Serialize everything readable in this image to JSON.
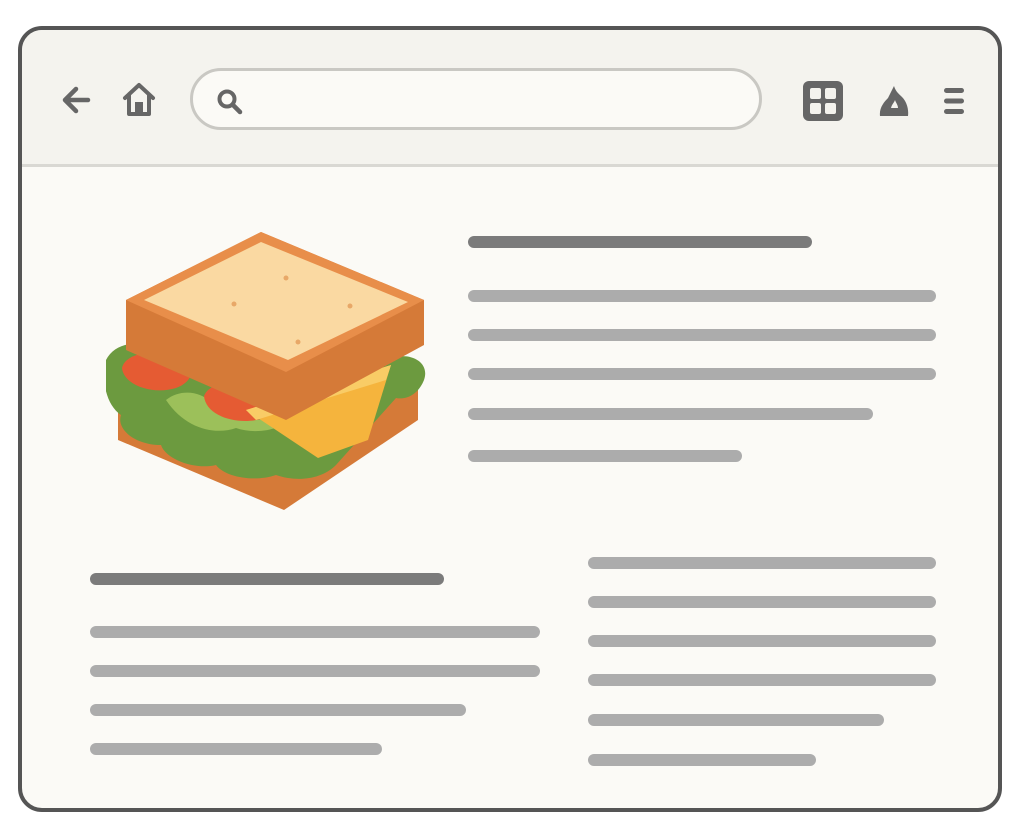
{
  "browser": {
    "toolbar_icons": [
      "back-arrow-icon",
      "home-icon",
      "search-icon",
      "grid-icon",
      "flame-icon",
      "menu-icon"
    ],
    "search": {
      "value": "",
      "placeholder": ""
    },
    "colors": {
      "frame": "#555555",
      "toolbar": "#f4f3ee",
      "page": "#fbfaf6",
      "heading_bar": "#7b7b7b",
      "text_bar": "#acacac"
    }
  },
  "page": {
    "hero_image": "sandwich-icon",
    "blocks": [
      "article-intro",
      "article-left",
      "article-right"
    ]
  }
}
